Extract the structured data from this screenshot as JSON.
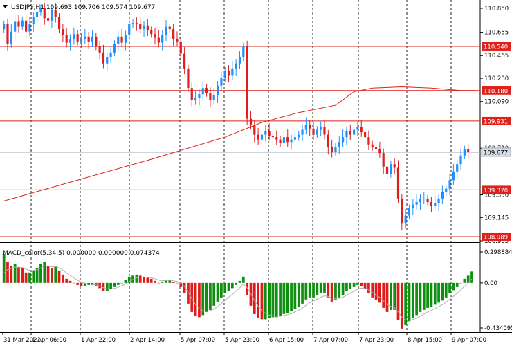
{
  "chart_data": {
    "type": "candlestick",
    "title": "USDJPY,H1  109.693 109.706 109.574 109.677",
    "symbol_header": "USDJPY,H1",
    "last_ohlc": {
      "open": 109.693,
      "high": 109.706,
      "low": 109.574,
      "close": 109.677
    },
    "price_ylim": [
      108.955,
      110.895
    ],
    "price_ticks": [
      "110.850",
      "110.655",
      "110.465",
      "110.280",
      "110.090",
      "109.710",
      "109.330",
      "109.145",
      "108.955"
    ],
    "levels": [
      {
        "label": "110.540",
        "value": 110.54
      },
      {
        "label": "110.180",
        "value": 110.18
      },
      {
        "label": "109.931",
        "value": 109.931
      },
      {
        "label": "109.370",
        "value": 109.37
      },
      {
        "label": "108.989",
        "value": 108.989
      }
    ],
    "current_price_label": "109.677",
    "x_labels": [
      "31 Mar 2021",
      "1 Apr 06:00",
      "1 Apr 22:00",
      "2 Apr 14:00",
      "5 Apr 07:00",
      "5 Apr 23:00",
      "6 Apr 15:00",
      "7 Apr 07:00",
      "7 Apr 23:00",
      "8 Apr 15:00",
      "9 Apr 07:00"
    ],
    "closes": [
      110.72,
      110.56,
      110.66,
      110.74,
      110.7,
      110.75,
      110.66,
      110.72,
      110.78,
      110.82,
      110.85,
      110.77,
      110.75,
      110.84,
      110.78,
      110.68,
      110.63,
      110.57,
      110.6,
      110.64,
      110.58,
      110.6,
      110.62,
      110.58,
      110.62,
      110.54,
      110.49,
      110.4,
      110.45,
      110.49,
      110.56,
      110.62,
      110.57,
      110.63,
      110.72,
      110.73,
      110.72,
      110.68,
      110.71,
      110.67,
      110.64,
      110.61,
      110.57,
      110.63,
      110.7,
      110.68,
      110.6,
      110.58,
      110.48,
      110.36,
      110.2,
      110.1,
      110.12,
      110.15,
      110.2,
      110.16,
      110.1,
      110.14,
      110.22,
      110.28,
      110.34,
      110.3,
      110.36,
      110.4,
      110.45,
      110.54,
      109.95,
      109.9,
      109.82,
      109.78,
      109.82,
      109.85,
      109.81,
      109.8,
      109.78,
      109.75,
      109.8,
      109.76,
      109.78,
      109.8,
      109.82,
      109.86,
      109.9,
      109.87,
      109.82,
      109.86,
      109.88,
      109.82,
      109.72,
      109.68,
      109.72,
      109.76,
      109.8,
      109.85,
      109.82,
      109.86,
      109.88,
      109.84,
      109.8,
      109.74,
      109.72,
      109.7,
      109.67,
      109.56,
      109.5,
      109.58,
      109.55,
      109.3,
      109.1,
      109.16,
      109.22,
      109.25,
      109.27,
      109.3,
      109.3,
      109.27,
      109.24,
      109.26,
      109.3,
      109.35,
      109.38,
      109.45,
      109.52,
      109.58,
      109.65,
      109.7,
      109.677
    ],
    "ma_line_name": "",
    "ma_points": [
      [
        0,
        109.28
      ],
      [
        20,
        109.45
      ],
      [
        40,
        109.62
      ],
      [
        60,
        109.8
      ],
      [
        70,
        109.92
      ],
      [
        80,
        110.0
      ],
      [
        90,
        110.06
      ],
      [
        95,
        110.17
      ],
      [
        100,
        110.2
      ],
      [
        108,
        110.21
      ],
      [
        116,
        110.2
      ],
      [
        124,
        110.18
      ],
      [
        128,
        110.18
      ]
    ],
    "macd": {
      "title": "MACD_color(5,34,5) 0.000000 0.000000 0.074374",
      "ylim": [
        -0.434095,
        0.298884
      ],
      "ticks": [
        "0.298884",
        "0.00",
        "-0.434095"
      ],
      "histogram": [
        0.28,
        0.2,
        0.16,
        0.18,
        0.15,
        0.14,
        0.1,
        0.1,
        0.12,
        0.14,
        0.18,
        0.2,
        0.16,
        0.14,
        0.16,
        0.12,
        0.08,
        0.04,
        0.02,
        0.0,
        -0.02,
        -0.03,
        -0.03,
        -0.02,
        -0.02,
        -0.03,
        -0.05,
        -0.08,
        -0.08,
        -0.06,
        -0.04,
        -0.02,
        0.0,
        0.03,
        0.06,
        0.07,
        0.08,
        0.07,
        0.06,
        0.05,
        0.04,
        0.02,
        0.0,
        0.01,
        0.03,
        0.03,
        0.01,
        0.0,
        -0.04,
        -0.1,
        -0.2,
        -0.28,
        -0.32,
        -0.33,
        -0.31,
        -0.28,
        -0.26,
        -0.22,
        -0.18,
        -0.14,
        -0.1,
        -0.08,
        -0.05,
        -0.02,
        0.02,
        0.06,
        -0.12,
        -0.22,
        -0.3,
        -0.34,
        -0.35,
        -0.35,
        -0.34,
        -0.33,
        -0.33,
        -0.32,
        -0.3,
        -0.29,
        -0.27,
        -0.25,
        -0.23,
        -0.2,
        -0.16,
        -0.14,
        -0.14,
        -0.12,
        -0.1,
        -0.1,
        -0.14,
        -0.18,
        -0.16,
        -0.14,
        -0.12,
        -0.08,
        -0.06,
        -0.04,
        -0.02,
        -0.03,
        -0.06,
        -0.1,
        -0.14,
        -0.16,
        -0.19,
        -0.24,
        -0.28,
        -0.26,
        -0.26,
        -0.36,
        -0.44,
        -0.4,
        -0.37,
        -0.34,
        -0.31,
        -0.28,
        -0.26,
        -0.24,
        -0.23,
        -0.21,
        -0.19,
        -0.17,
        -0.14,
        -0.1,
        -0.07,
        -0.04,
        0.0,
        0.04,
        0.07,
        0.11
      ]
    },
    "colors": {
      "bull": "#1e90ff",
      "bear": "#dd1f1f",
      "level_line": "#e0211b",
      "ma_line": "#e0211b",
      "current_line": "#9aa7b5",
      "macd_up": "#0f8f0f",
      "macd_down": "#e01b1b",
      "macd_signal": "#b0b0b0"
    }
  }
}
